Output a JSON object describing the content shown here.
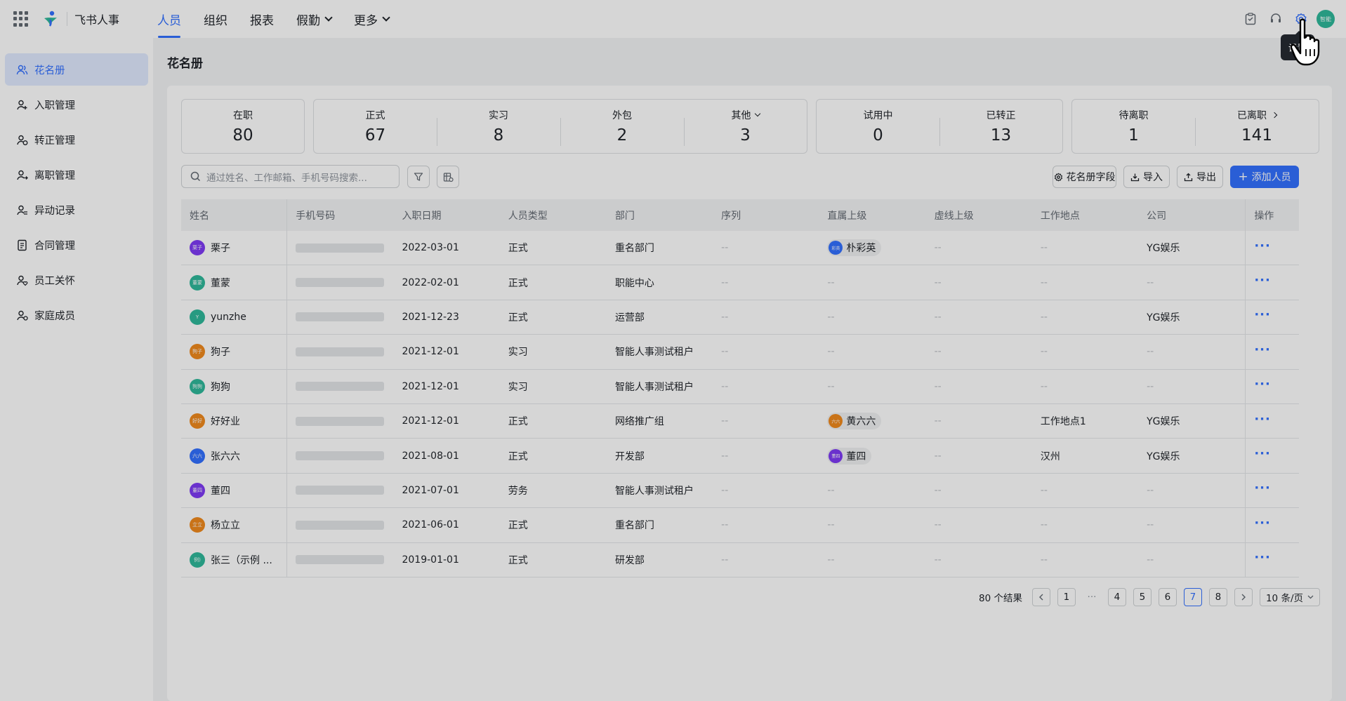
{
  "brand": "飞书人事",
  "nav": [
    "人员",
    "组织",
    "报表",
    "假勤",
    "更多"
  ],
  "tooltip": "设置",
  "user_avatar": "智能",
  "sidebar": [
    "花名册",
    "入职管理",
    "转正管理",
    "离职管理",
    "异动记录",
    "合同管理",
    "员工关怀",
    "家庭成员"
  ],
  "page_title": "花名册",
  "stats": {
    "active": {
      "label": "在职",
      "value": "80"
    },
    "regular": {
      "label": "正式",
      "value": "67"
    },
    "intern": {
      "label": "实习",
      "value": "8"
    },
    "outsource": {
      "label": "外包",
      "value": "2"
    },
    "other": {
      "label": "其他",
      "value": "3"
    },
    "probation": {
      "label": "试用中",
      "value": "0"
    },
    "confirmed": {
      "label": "已转正",
      "value": "13"
    },
    "pending_leave": {
      "label": "待离职",
      "value": "1"
    },
    "left": {
      "label": "已离职",
      "value": "141"
    }
  },
  "search_placeholder": "通过姓名、工作邮箱、手机号码搜索...",
  "buttons": {
    "fields": "花名册字段",
    "import": "导入",
    "export": "导出",
    "add": "添加人员"
  },
  "columns": [
    "姓名",
    "手机号码",
    "入职日期",
    "人员类型",
    "部门",
    "序列",
    "直属上级",
    "虚线上级",
    "工作地点",
    "公司",
    "操作"
  ],
  "rows": [
    {
      "name": "栗子",
      "avatar": "栗子",
      "color": "#7f3bf5",
      "date": "2022-03-01",
      "type": "正式",
      "dept": "重名部门",
      "seq": "--",
      "manager": "朴彩英",
      "manager_avatar": "彩英",
      "manager_color": "#3370ff",
      "dotted": "--",
      "location": "--",
      "company": "YG娱乐"
    },
    {
      "name": "董蒙",
      "avatar": "董蒙",
      "color": "#2fb89a",
      "date": "2022-02-01",
      "type": "正式",
      "dept": "职能中心",
      "seq": "--",
      "manager": "--",
      "dotted": "--",
      "location": "--",
      "company": "--"
    },
    {
      "name": "yunzhe",
      "avatar": "Y",
      "color": "#2fb89a",
      "date": "2021-12-23",
      "type": "正式",
      "dept": "运营部",
      "seq": "--",
      "manager": "--",
      "dotted": "--",
      "location": "--",
      "company": "YG娱乐"
    },
    {
      "name": "狗子",
      "avatar": "狗子",
      "color": "#f08a1d",
      "date": "2021-12-01",
      "type": "实习",
      "dept": "智能人事测试租户",
      "seq": "--",
      "manager": "--",
      "dotted": "--",
      "location": "--",
      "company": "--"
    },
    {
      "name": "狗狗",
      "avatar": "狗狗",
      "color": "#2fb89a",
      "date": "2021-12-01",
      "type": "实习",
      "dept": "智能人事测试租户",
      "seq": "--",
      "manager": "--",
      "dotted": "--",
      "location": "--",
      "company": "--"
    },
    {
      "name": "好好业",
      "avatar": "好好",
      "color": "#f08a1d",
      "date": "2021-12-01",
      "type": "正式",
      "dept": "网络推广组",
      "seq": "--",
      "manager": "黄六六",
      "manager_avatar": "六六",
      "manager_color": "#f08a1d",
      "dotted": "--",
      "location": "工作地点1",
      "company": "YG娱乐"
    },
    {
      "name": "张六六",
      "avatar": "六六",
      "color": "#3370ff",
      "date": "2021-08-01",
      "type": "正式",
      "dept": "开发部",
      "seq": "--",
      "manager": "董四",
      "manager_avatar": "董四",
      "manager_color": "#7f3bf5",
      "dotted": "--",
      "location": "汉州",
      "company": "YG娱乐"
    },
    {
      "name": "董四",
      "avatar": "董四",
      "color": "#7f3bf5",
      "date": "2021-07-01",
      "type": "劳务",
      "dept": "智能人事测试租户",
      "seq": "--",
      "manager": "--",
      "dotted": "--",
      "location": "--",
      "company": "--"
    },
    {
      "name": "杨立立",
      "avatar": "立立",
      "color": "#f08a1d",
      "date": "2021-06-01",
      "type": "正式",
      "dept": "重名部门",
      "seq": "--",
      "manager": "--",
      "dotted": "--",
      "location": "--",
      "company": "--"
    },
    {
      "name": "张三（示例 ...",
      "avatar": "例)",
      "color": "#2fb89a",
      "date": "2019-01-01",
      "type": "正式",
      "dept": "研发部",
      "seq": "--",
      "manager": "--",
      "dotted": "--",
      "location": "--",
      "company": "--"
    }
  ],
  "row_action": "···",
  "pagination": {
    "total": "80 个结果",
    "pages": [
      "1",
      "···",
      "4",
      "5",
      "6",
      "7",
      "8"
    ],
    "current": "7",
    "page_size": "10 条/页"
  }
}
